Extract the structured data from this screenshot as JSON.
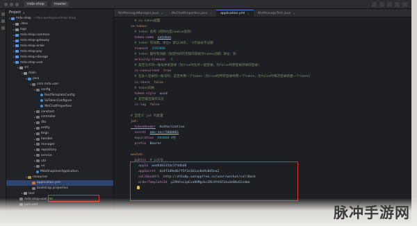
{
  "titlebar": {
    "project_menu": "mdx-shop",
    "branch": "master"
  },
  "project_panel": {
    "header": "Project",
    "tree": [
      {
        "label": "mdx-shop",
        "path": "~/dev-workspace/mdx-shop",
        "level": 0,
        "icon": "module-folder",
        "expanded": true
      },
      {
        "label": ".idea",
        "level": 1,
        "icon": "folder",
        "expanded": false
      },
      {
        "label": "logs",
        "level": 1,
        "icon": "folder",
        "expanded": false
      },
      {
        "label": "mdx-shop-common",
        "level": 1,
        "icon": "module-folder",
        "expanded": false
      },
      {
        "label": "mdx-shop-gateway",
        "level": 1,
        "icon": "module-folder",
        "expanded": false
      },
      {
        "label": "mdx-shop-order",
        "level": 1,
        "icon": "module-folder",
        "expanded": false
      },
      {
        "label": "mdx-shop-pay",
        "level": 1,
        "icon": "module-folder",
        "expanded": false
      },
      {
        "label": "mdx-shop-storage",
        "level": 1,
        "icon": "module-folder",
        "expanded": false
      },
      {
        "label": "mdx-shop-user",
        "level": 1,
        "icon": "module-folder",
        "expanded": true
      },
      {
        "label": "src",
        "level": 2,
        "icon": "folder",
        "expanded": true
      },
      {
        "label": "main",
        "level": 3,
        "icon": "folder",
        "expanded": true
      },
      {
        "label": "java",
        "level": 4,
        "icon": "src-folder",
        "expanded": true
      },
      {
        "label": "com.mdx.user",
        "level": 5,
        "icon": "package",
        "expanded": true
      },
      {
        "label": "config",
        "level": 6,
        "icon": "package",
        "expanded": true
      },
      {
        "label": "RestTemplateConfig",
        "level": 7,
        "icon": "class"
      },
      {
        "label": "SaTokenConfigure",
        "level": 7,
        "icon": "class"
      },
      {
        "label": "WeChatProperties",
        "level": 7,
        "icon": "class"
      },
      {
        "label": "constant",
        "level": 6,
        "icon": "package",
        "expanded": false
      },
      {
        "label": "controller",
        "level": 6,
        "icon": "package",
        "expanded": false
      },
      {
        "label": "dto",
        "level": 6,
        "icon": "package",
        "expanded": false
      },
      {
        "label": "entity",
        "level": 6,
        "icon": "package",
        "expanded": false
      },
      {
        "label": "feign",
        "level": 6,
        "icon": "package",
        "expanded": false
      },
      {
        "label": "handler",
        "level": 6,
        "icon": "package",
        "expanded": false
      },
      {
        "label": "manager",
        "level": 6,
        "icon": "package",
        "expanded": false
      },
      {
        "label": "repository",
        "level": 6,
        "icon": "package",
        "expanded": false
      },
      {
        "label": "service",
        "level": 6,
        "icon": "package",
        "expanded": false
      },
      {
        "label": "util",
        "level": 6,
        "icon": "package",
        "expanded": false
      },
      {
        "label": "vo",
        "level": 6,
        "icon": "package",
        "expanded": false
      },
      {
        "label": "MdxShopUserApplication",
        "level": 6,
        "icon": "class"
      },
      {
        "label": "resources",
        "level": 4,
        "icon": "resources-folder",
        "expanded": true
      },
      {
        "label": "application.yml",
        "level": 5,
        "icon": "yml",
        "selected": true
      },
      {
        "label": "bootstrap.properties",
        "level": 5,
        "icon": "file"
      },
      {
        "label": "test",
        "level": 3,
        "icon": "folder",
        "expanded": false
      },
      {
        "label": "mdx-shop-user.iml",
        "level": 2,
        "icon": "file"
      },
      {
        "label": "pom.xml",
        "level": 2,
        "icon": "file"
      }
    ]
  },
  "editor": {
    "tabs": [
      {
        "label": "WxMessageManager.java",
        "active": false
      },
      {
        "label": "WeChatProperties.java",
        "active": false
      },
      {
        "label": "application.yml",
        "active": true
      },
      {
        "label": "WxMessageTest.java",
        "active": false
      }
    ],
    "lines": [
      [
        {
          "t": "  # sa-token配置",
          "c": "cm"
        }
      ],
      [
        {
          "t": "sa-token:",
          "c": "k"
        }
      ],
      [
        {
          "t": "  # token 名称（同时也是cookie名称）",
          "c": "cm"
        }
      ],
      [
        {
          "t": "  token-name",
          "c": "key"
        },
        {
          "t": ": "
        },
        {
          "t": "satoken",
          "c": "v u"
        }
      ],
      [
        {
          "t": "  # token 有效期，单位s 默认30天, -1代表永不过期",
          "c": "cm"
        }
      ],
      [
        {
          "t": "  timeout",
          "c": "key"
        },
        {
          "t": ": "
        },
        {
          "t": "2592000",
          "c": "num"
        }
      ],
      [
        {
          "t": "  # token 临时有效期（指定时间内无操作就视为token过期）单位：秒",
          "c": "cm"
        }
      ],
      [
        {
          "t": "  activity-timeout",
          "c": "key"
        },
        {
          "t": ": "
        },
        {
          "t": "-1",
          "c": "num"
        }
      ],
      [
        {
          "t": "  # 是否允许同一账号并发登录（为true时允许一起登录，为false时新登录挤掉旧登录）",
          "c": "cm"
        }
      ],
      [
        {
          "t": "  is-concurrent",
          "c": "key"
        },
        {
          "t": ": "
        },
        {
          "t": "true",
          "c": "k"
        }
      ],
      [
        {
          "t": "  # 在多人登录同一账号时，是否共用一个token（为true时所有登录共用一个token，为false时每次登录新建一个token）",
          "c": "cm"
        }
      ],
      [
        {
          "t": "  is-share",
          "c": "key"
        },
        {
          "t": ": "
        },
        {
          "t": "false",
          "c": "k"
        }
      ],
      [
        {
          "t": "  # token风格",
          "c": "cm"
        }
      ],
      [
        {
          "t": "  token-style",
          "c": "key"
        },
        {
          "t": ": "
        },
        {
          "t": "uuid",
          "c": "v"
        }
      ],
      [
        {
          "t": "  # 是否输出操作日志",
          "c": "cm"
        }
      ],
      [
        {
          "t": "  is-log",
          "c": "key"
        },
        {
          "t": ": "
        },
        {
          "t": "false",
          "c": "k"
        }
      ],
      [
        {
          "t": ""
        }
      ],
      [
        {
          "t": "# 自定义 jwt 的配置",
          "c": "cm"
        }
      ],
      [
        {
          "t": "jwt:",
          "c": "k"
        }
      ],
      [
        {
          "t": "  tokenHeader",
          "c": "key u"
        },
        {
          "t": ": "
        },
        {
          "t": "Authorization",
          "c": "v"
        }
      ],
      [
        {
          "t": "  secret",
          "c": "key"
        },
        {
          "t": ": "
        },
        {
          "t": "mdx-secr5000001",
          "c": "v u"
        }
      ],
      [
        {
          "t": "  expiration",
          "c": "key"
        },
        {
          "t": ": "
        },
        {
          "t": "604800",
          "c": "num"
        },
        {
          "t": " #秒",
          "c": "cm"
        }
      ],
      [
        {
          "t": "  prefix",
          "c": "key"
        },
        {
          "t": ": "
        },
        {
          "t": "Bearer",
          "c": "v"
        }
      ],
      [
        {
          "t": ""
        }
      ],
      [
        {
          "t": "wechat:",
          "c": "k"
        }
      ],
      [
        {
          "t": "  public",
          "c": "key"
        },
        {
          "t": ": "
        },
        {
          "t": "# 公众号",
          "c": "cm"
        }
      ],
      [
        {
          "t": "    appId",
          "c": "key"
        },
        {
          "t": ": "
        },
        {
          "t": "wxd4d6315dc1f4dbd8",
          "c": "v"
        }
      ],
      [
        {
          "t": "    appSecret",
          "c": "key"
        },
        {
          "t": ": "
        },
        {
          "t": "dc4f1d9e4b7f5f2e3b1ac8a9c0d5ea2",
          "c": "v"
        }
      ],
      [
        {
          "t": "    callBackUrl",
          "c": "key"
        },
        {
          "t": ": "
        },
        {
          "t": "http://zh5x8p.natappfree.cc/user/wechat/callBack",
          "c": "v"
        }
      ],
      [
        {
          "t": "    orderTemplateId",
          "c": "key"
        },
        {
          "t": ": "
        },
        {
          "t": "p29hFes1pEvu9HMgzks2RL9Yh9Z14u3eGNvO2zdmo",
          "c": "v"
        }
      ],
      [
        {
          "t": ""
        }
      ],
      [
        {
          "t": ""
        }
      ],
      [
        {
          "t": ""
        }
      ],
      [
        {
          "t": ""
        }
      ],
      [
        {
          "t": ""
        }
      ],
      [
        {
          "t": ""
        }
      ]
    ]
  },
  "watermark": "脉冲手游网"
}
